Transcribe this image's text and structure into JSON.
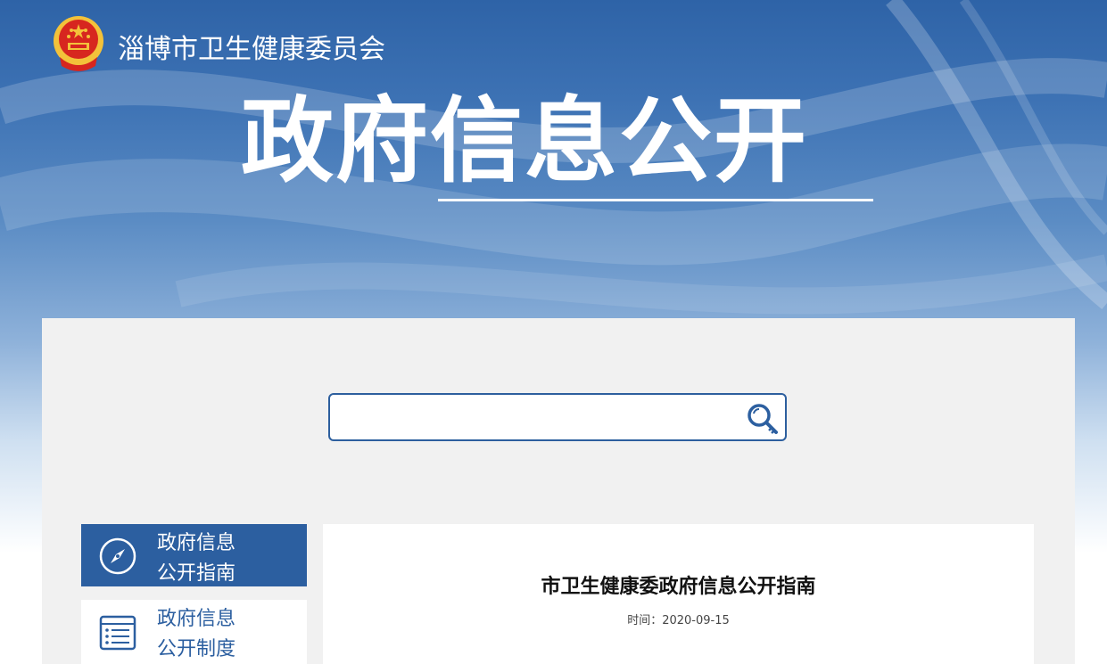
{
  "header": {
    "org_name": "淄博市卫生健康委员会",
    "hero_title": "政府信息公开",
    "logo_icon": "national-emblem-icon"
  },
  "search": {
    "value": "",
    "placeholder": "",
    "icon": "search-key-icon"
  },
  "sidebar": {
    "items": [
      {
        "label": "政府信息\n公开指南",
        "icon": "compass-icon",
        "active": true
      },
      {
        "label": "政府信息\n公开制度",
        "icon": "document-list-icon",
        "active": false
      }
    ]
  },
  "content": {
    "title": "市卫生健康委政府信息公开指南",
    "time_label": "时间：",
    "time_value": "2020-09-15"
  },
  "colors": {
    "primary": "#2c5fa0",
    "panel_bg": "#f1f1f1",
    "emblem_red": "#d7261f",
    "emblem_gold": "#f3c23a"
  }
}
